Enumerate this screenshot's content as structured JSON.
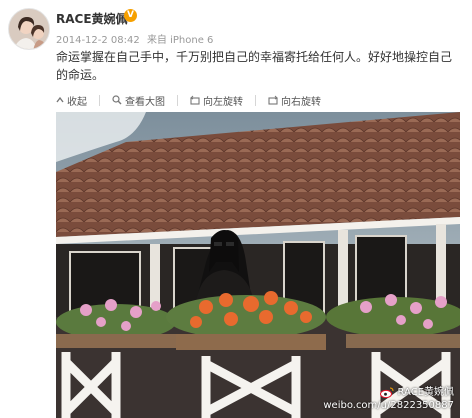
{
  "user": {
    "name": "RACE黄婉佩",
    "verified_mark": "V"
  },
  "post": {
    "time": "2014-12-2 08:42",
    "source": "来自 iPhone 6",
    "text": "命运掌握在自己手中，千万别把自己的幸福寄托给任何人。好好地操控自己的命运。"
  },
  "toolbar": {
    "collapse_label": "收起",
    "view_large_label": "查看大图",
    "rotate_left_label": "向左旋转",
    "rotate_right_label": "向右旋转"
  },
  "watermark": {
    "name": "RACE黄婉佩",
    "url": "weibo.com/u/2822350887"
  },
  "colors": {
    "accent": "#f6a000",
    "text": "#333333",
    "meta": "#999999"
  },
  "icons": [
    "avatar",
    "verified-badge",
    "collapse-icon",
    "zoom-icon",
    "rotate-left-icon",
    "rotate-right-icon",
    "weibo-logo-icon"
  ]
}
